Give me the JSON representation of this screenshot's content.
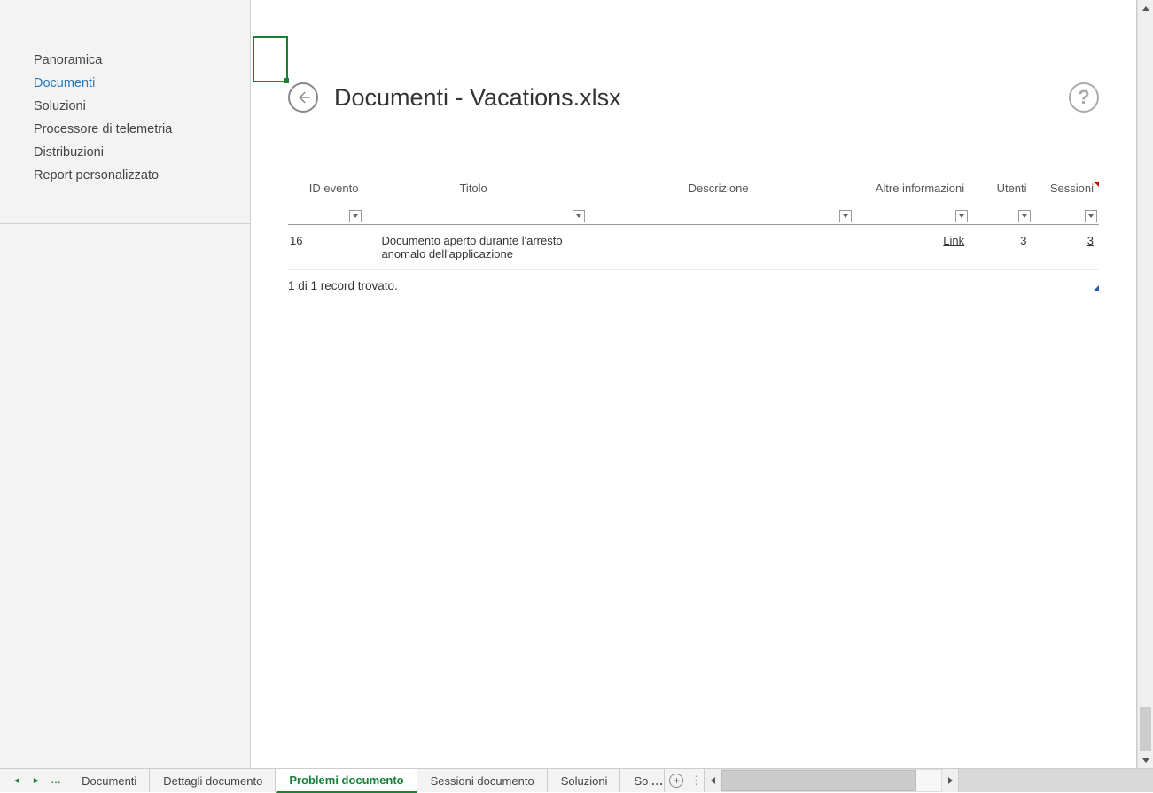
{
  "sidebar": {
    "items": [
      {
        "label": "Panoramica"
      },
      {
        "label": "Documenti"
      },
      {
        "label": "Soluzioni"
      },
      {
        "label": "Processore di telemetria"
      },
      {
        "label": "Distribuzioni"
      },
      {
        "label": "Report personalizzato"
      }
    ],
    "active_index": 1
  },
  "page": {
    "title": "Documenti - Vacations.xlsx"
  },
  "table": {
    "headers": {
      "event_id": "ID evento",
      "title": "Titolo",
      "description": "Descrizione",
      "more_info": "Altre informazioni",
      "users": "Utenti",
      "sessions": "Sessioni"
    },
    "rows": [
      {
        "event_id": "16",
        "title": "Documento aperto durante l'arresto anomalo dell'applicazione",
        "description": "",
        "more_info_label": "Link",
        "users": "3",
        "sessions": "3"
      }
    ],
    "footer": "1 di 1 record trovato."
  },
  "tabs": {
    "items": [
      {
        "label": "Documenti"
      },
      {
        "label": "Dettagli documento"
      },
      {
        "label": "Problemi documento"
      },
      {
        "label": "Sessioni documento"
      },
      {
        "label": "Soluzioni"
      },
      {
        "label": "So"
      }
    ],
    "active_index": 2,
    "overflow": "..."
  }
}
